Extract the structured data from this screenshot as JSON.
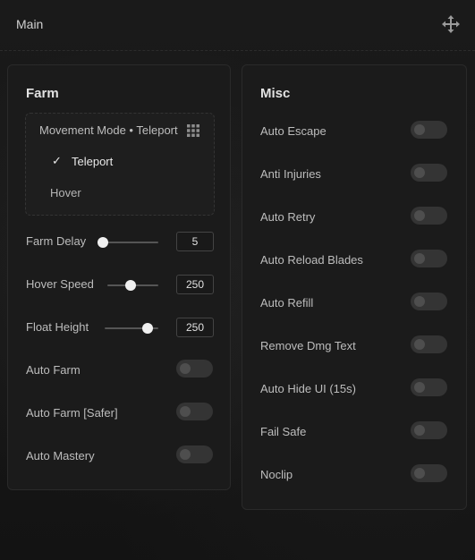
{
  "header": {
    "title": "Main",
    "move_icon": "move-arrows-icon"
  },
  "farm": {
    "title": "Farm",
    "movement_mode": {
      "label": "Movement Mode • Teleport",
      "options": [
        {
          "label": "Teleport",
          "selected": true
        },
        {
          "label": "Hover",
          "selected": false
        }
      ]
    },
    "sliders": [
      {
        "label": "Farm Delay",
        "value": "5",
        "level": 0.0
      },
      {
        "label": "Hover Speed",
        "value": "250",
        "level": 0.45
      },
      {
        "label": "Float Height",
        "value": "250",
        "level": 0.8
      }
    ],
    "toggles": [
      {
        "label": "Auto Farm",
        "on": false
      },
      {
        "label": "Auto Farm [Safer]",
        "on": false
      },
      {
        "label": "Auto Mastery",
        "on": false
      }
    ]
  },
  "misc": {
    "title": "Misc",
    "toggles": [
      {
        "label": "Auto Escape",
        "on": false
      },
      {
        "label": "Anti Injuries",
        "on": false
      },
      {
        "label": "Auto Retry",
        "on": false
      },
      {
        "label": "Auto Reload Blades",
        "on": false
      },
      {
        "label": "Auto Refill",
        "on": false
      },
      {
        "label": "Remove Dmg Text",
        "on": false
      },
      {
        "label": "Auto Hide UI (15s)",
        "on": false
      },
      {
        "label": "Fail Safe",
        "on": false
      },
      {
        "label": "Noclip",
        "on": false
      }
    ]
  },
  "colors": {
    "panel": "#1b1b1b",
    "toggle_off": "#343434",
    "thumb": "#f0f0f0"
  }
}
